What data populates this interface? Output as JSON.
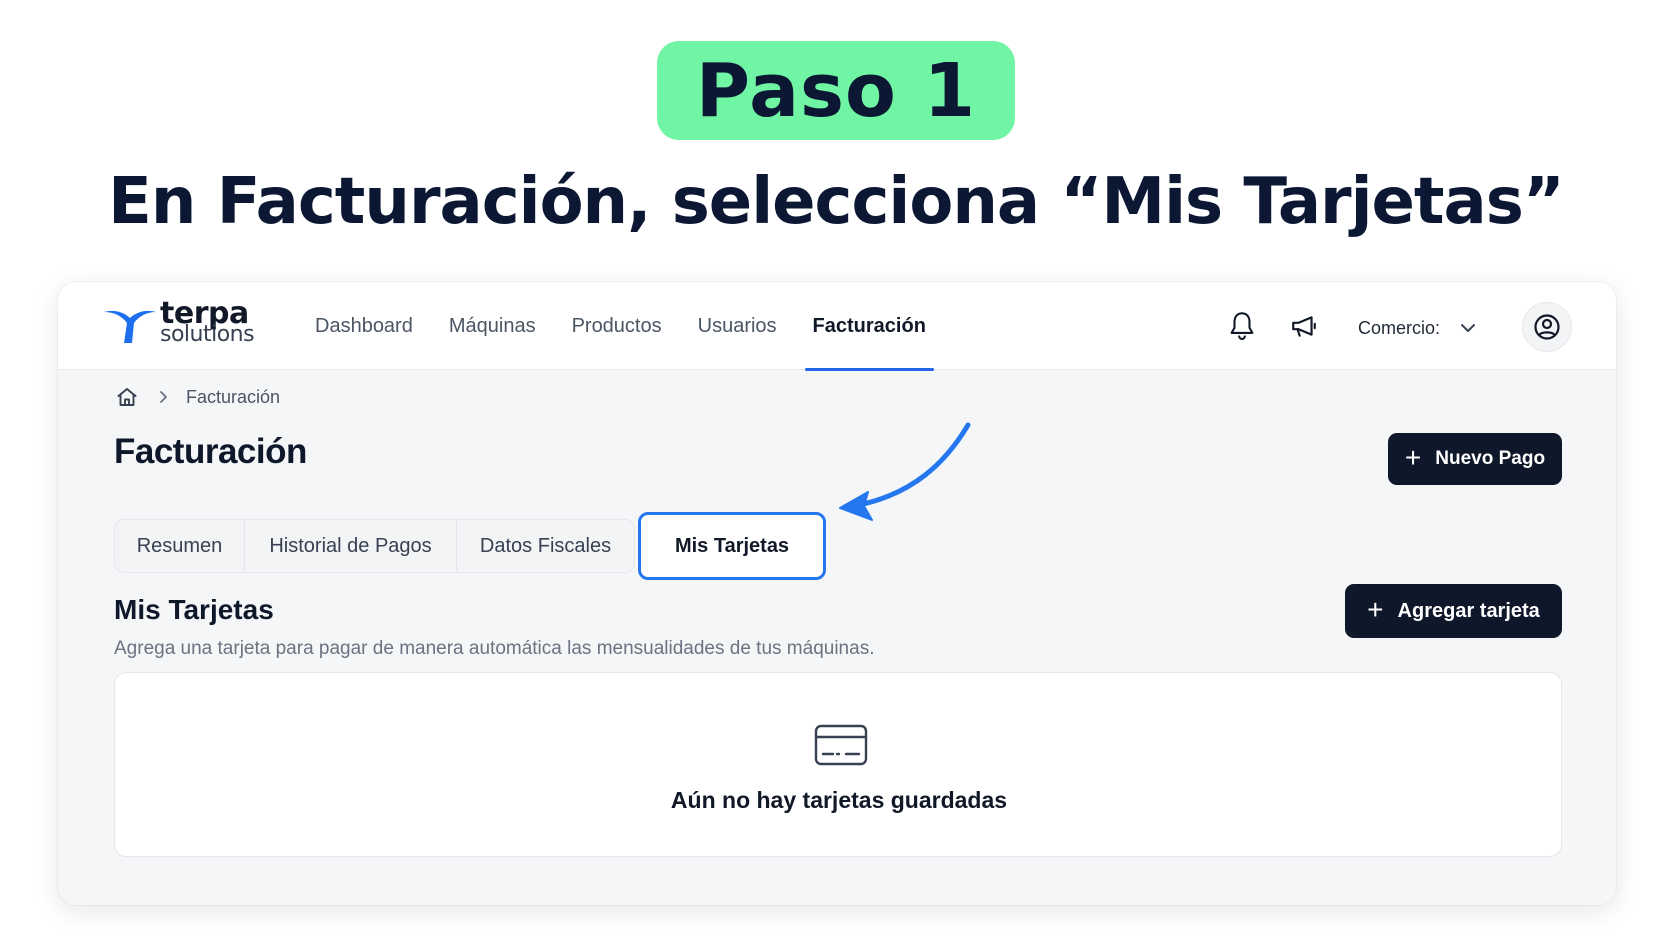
{
  "banner": {
    "step": "Paso 1",
    "instruction": "En Facturación, selecciona “Mis Tarjetas”"
  },
  "header": {
    "logo_title": "terpa",
    "logo_subtitle": "solutions",
    "nav": [
      {
        "label": "Dashboard"
      },
      {
        "label": "Máquinas"
      },
      {
        "label": "Productos"
      },
      {
        "label": "Usuarios"
      },
      {
        "label": "Facturación",
        "active": true
      }
    ],
    "merchant_label": "Comercio:",
    "icons": [
      "bell-icon",
      "megaphone-icon",
      "chevron-down-icon",
      "user-circle-icon"
    ]
  },
  "breadcrumb": {
    "current": "Facturación"
  },
  "page": {
    "title": "Facturación",
    "new_payment_label": "Nuevo Pago"
  },
  "tabs": [
    {
      "label": "Resumen"
    },
    {
      "label": "Historial de Pagos"
    },
    {
      "label": "Datos Fiscales"
    },
    {
      "label": "Mis Tarjetas",
      "active": true
    }
  ],
  "cards_section": {
    "title": "Mis Tarjetas",
    "description": "Agrega una tarjeta para pagar de manera automática las mensualidades de tus máquinas.",
    "add_label": "Agregar tarjeta",
    "empty_message": "Aún no hay tarjetas guardadas"
  },
  "colors": {
    "badge_bg": "#6ff5a3",
    "primary_dark": "#0f172a",
    "accent_blue": "#2477ee",
    "logo_blue": "#1e6ff0"
  }
}
